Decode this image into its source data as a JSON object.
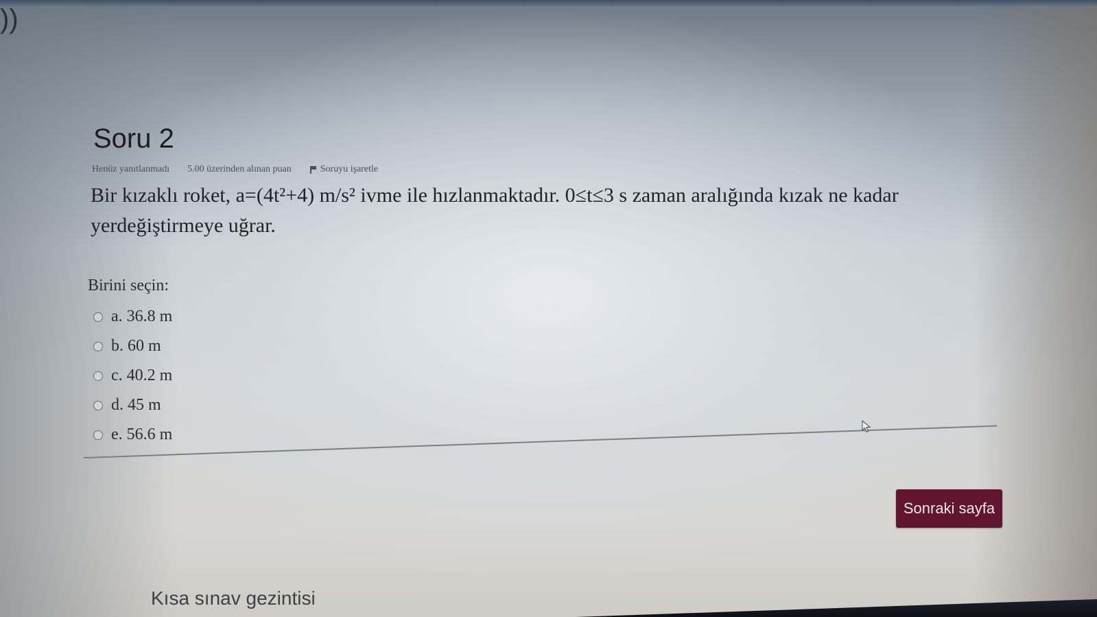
{
  "question": {
    "title": "Soru 2",
    "status": "Henüz yanıtlanmadı",
    "points": "5.00 üzerinden alınan puan",
    "flag_label": "Soruyu işaretle",
    "text": "Bir kızaklı roket, a=(4t²+4) m/s² ivme ile hızlanmaktadır. 0≤t≤3 s zaman aralığında kızak ne kadar yerdeğiştirmeye uğrar."
  },
  "answer": {
    "prompt": "Birini seçin:",
    "options": [
      {
        "label": "a. 36.8 m"
      },
      {
        "label": "b. 60 m"
      },
      {
        "label": "c. 40.2 m"
      },
      {
        "label": "d. 45 m"
      },
      {
        "label": "e. 56.6 m"
      }
    ]
  },
  "navigation": {
    "next_label": "Sonraki sayfa",
    "quiz_nav_label": "Kısa sınav gezintisi"
  },
  "colors": {
    "button_bg": "#62152f",
    "button_text": "#f3e6ea"
  },
  "icons": {
    "flag": "flag-icon",
    "radio": "radio-icon",
    "cursor": "mouse-cursor-icon"
  }
}
